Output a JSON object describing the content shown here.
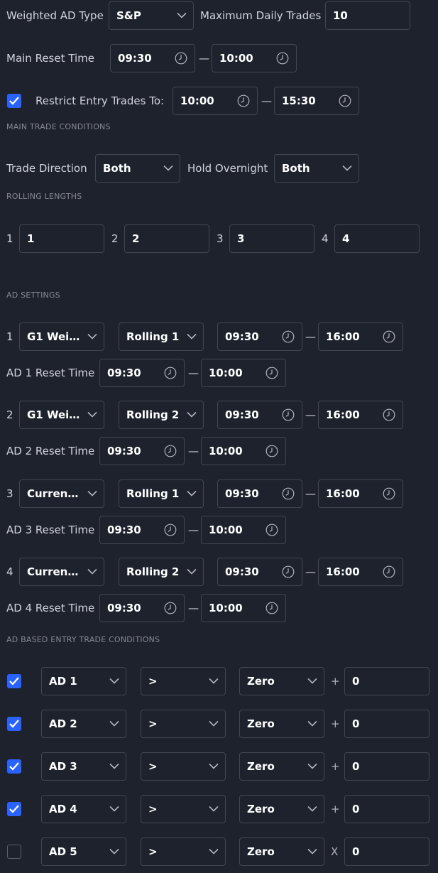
{
  "top": {
    "weighted_ad_type_label": "Weighted AD Type",
    "weighted_ad_type_value": "S&P",
    "max_daily_trades_label": "Maximum Daily Trades",
    "max_daily_trades_value": "10",
    "main_reset_label": "Main Reset Time",
    "main_reset_start": "09:30",
    "main_reset_end": "10:00",
    "restrict_checked": true,
    "restrict_label": "Restrict Entry Trades To:",
    "restrict_start": "10:00",
    "restrict_end": "15:30"
  },
  "main_conditions": {
    "title": "MAIN TRADE CONDITIONS",
    "trade_direction_label": "Trade Direction",
    "trade_direction_value": "Both",
    "hold_overnight_label": "Hold Overnight",
    "hold_overnight_value": "Both"
  },
  "rolling": {
    "title": "ROLLING LENGTHS",
    "items": [
      {
        "index": "1",
        "value": "1"
      },
      {
        "index": "2",
        "value": "2"
      },
      {
        "index": "3",
        "value": "3"
      },
      {
        "index": "4",
        "value": "4"
      }
    ]
  },
  "ad_settings": {
    "title": "AD SETTINGS",
    "rows": [
      {
        "index": "1",
        "type": "G1 Weig...",
        "rolling": "Rolling 1",
        "start": "09:30",
        "end": "16:00",
        "reset_label": "AD 1 Reset Time",
        "reset_start": "09:30",
        "reset_end": "10:00"
      },
      {
        "index": "2",
        "type": "G1 Weig...",
        "rolling": "Rolling 2",
        "start": "09:30",
        "end": "16:00",
        "reset_label": "AD 2 Reset Time",
        "reset_start": "09:30",
        "reset_end": "10:00"
      },
      {
        "index": "3",
        "type": "Current ...",
        "rolling": "Rolling 1",
        "start": "09:30",
        "end": "16:00",
        "reset_label": "AD 3 Reset Time",
        "reset_start": "09:30",
        "reset_end": "10:00"
      },
      {
        "index": "4",
        "type": "Current ...",
        "rolling": "Rolling 2",
        "start": "09:30",
        "end": "16:00",
        "reset_label": "AD 4 Reset Time",
        "reset_start": "09:30",
        "reset_end": "10:00"
      }
    ]
  },
  "entry_conditions": {
    "title": "AD BASED ENTRY TRADE CONDITIONS",
    "rows": [
      {
        "checked": true,
        "ad": "AD 1",
        "op": ">",
        "ref": "Zero",
        "math": "+",
        "value": "0"
      },
      {
        "checked": true,
        "ad": "AD 2",
        "op": ">",
        "ref": "Zero",
        "math": "+",
        "value": "0"
      },
      {
        "checked": true,
        "ad": "AD 3",
        "op": ">",
        "ref": "Zero",
        "math": "+",
        "value": "0"
      },
      {
        "checked": true,
        "ad": "AD 4",
        "op": ">",
        "ref": "Zero",
        "math": "+",
        "value": "0"
      },
      {
        "checked": false,
        "ad": "AD 5",
        "op": ">",
        "ref": "Zero",
        "math": "X",
        "value": "0"
      }
    ]
  },
  "icons": {
    "dropdown": "chevron-down-icon",
    "time": "clock-icon",
    "check": "check-icon"
  },
  "colors": {
    "background": "#1e222d",
    "border": "#434651",
    "accent": "#2962ff",
    "text": "#d1d4dc",
    "muted": "#868993"
  }
}
